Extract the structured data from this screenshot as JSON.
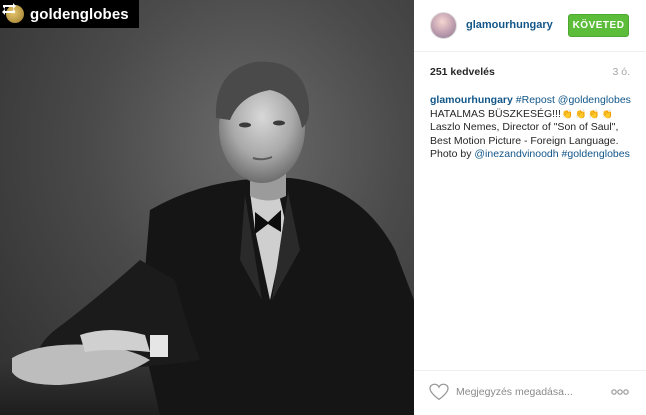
{
  "repost_badge": {
    "account": "goldenglobes"
  },
  "post": {
    "username": "glamourhungary",
    "follow_label": "KÖVETED",
    "likes": "251 kedvelés",
    "time_ago": "3 ó.",
    "caption": {
      "user": "glamourhungary",
      "tag_repost": "#Repost",
      "mention_source": "@goldenglobes",
      "line2_text": "HATALMAS BÜSZKESÉG!!!",
      "line3": "Laszlo Nemes, Director of \"Son of Saul\",",
      "line4": "Best Motion Picture - Foreign Language.",
      "photo_by": "Photo by",
      "mention_photographer": "@inezandvinoodh",
      "tag_goldenglobes": "#goldenglobes"
    },
    "comment_placeholder": "Megjegyzés megadása..."
  },
  "icons": [
    "repost-icon",
    "heart-icon",
    "more-options-icon",
    "clap-emoji"
  ],
  "colors": {
    "follow_button": "#5cbd3b",
    "link": "#125688",
    "muted": "#a5a7aa"
  }
}
